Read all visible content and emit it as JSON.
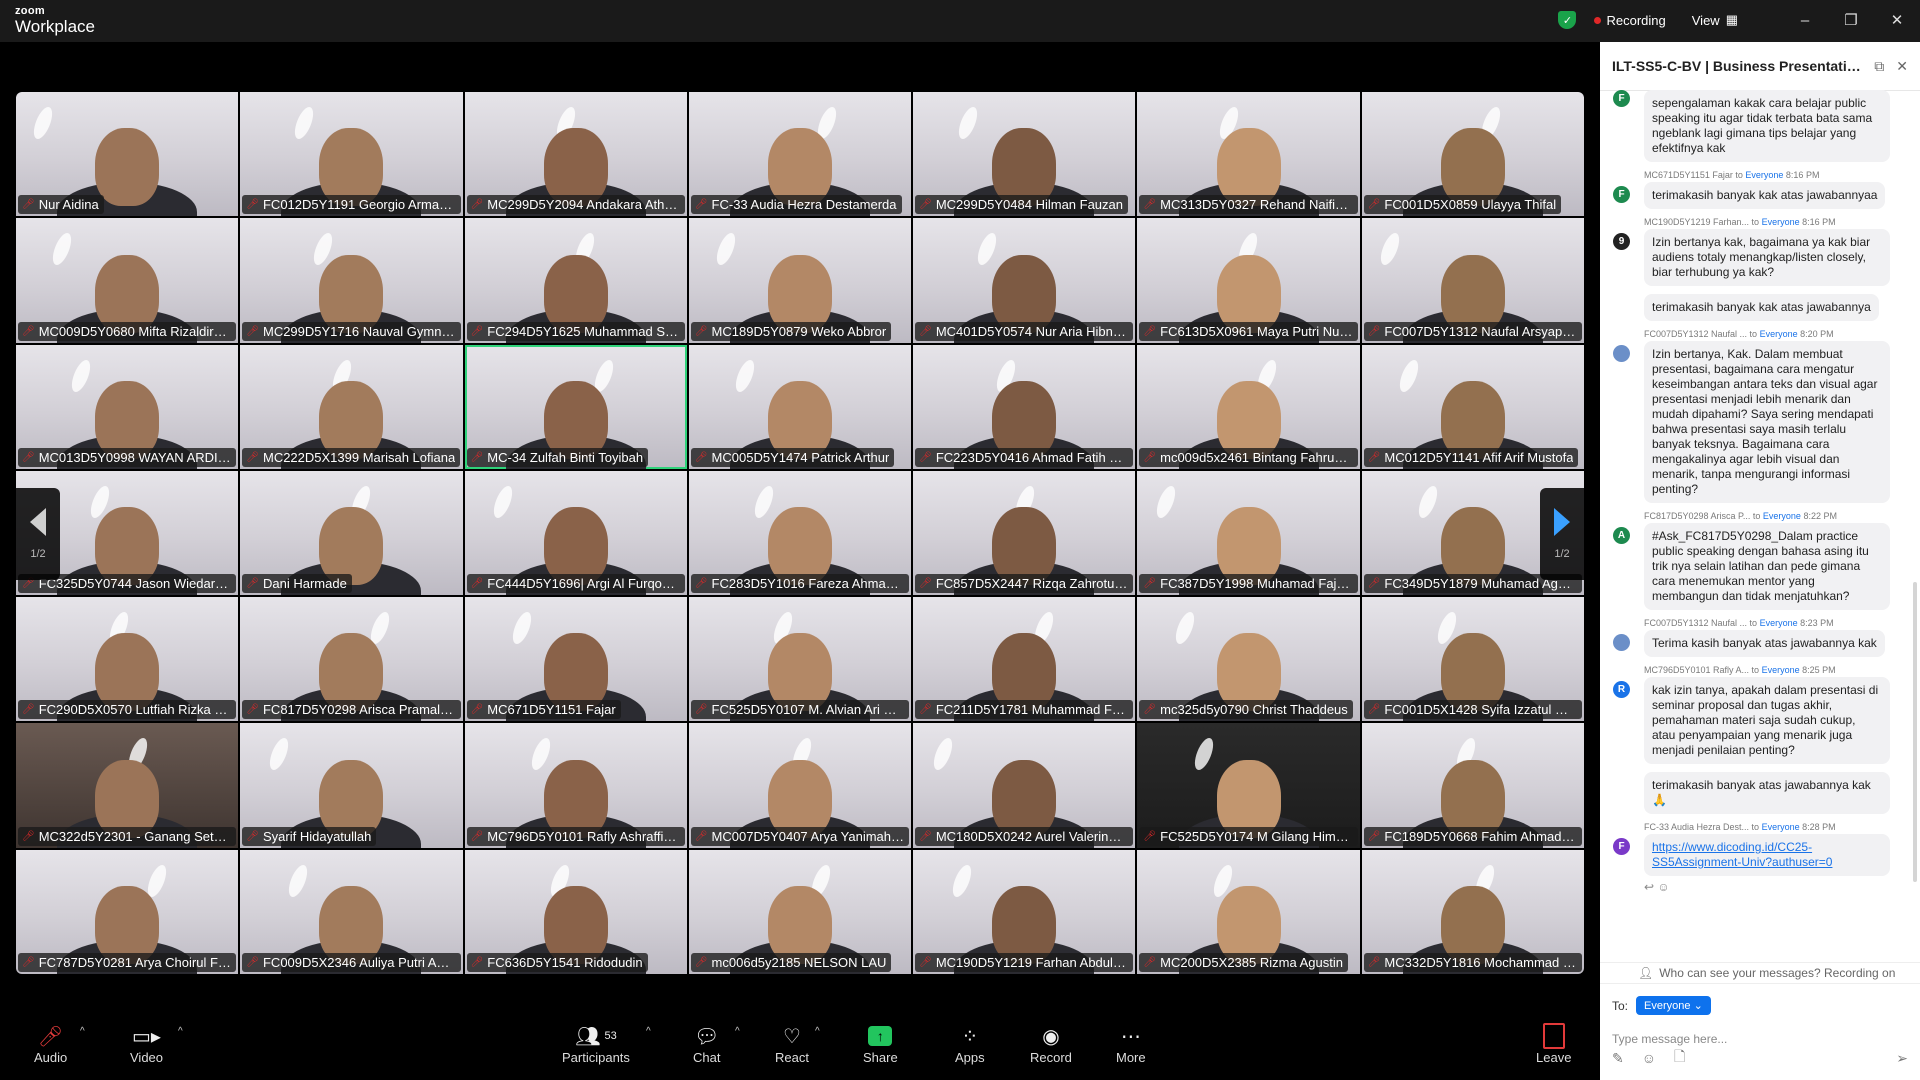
{
  "app": {
    "brand_top": "zoom",
    "brand_bottom": "Workplace"
  },
  "titlebar": {
    "recording_label": "Recording",
    "view_label": "View",
    "minimize": "–",
    "restore": "❐",
    "close": "✕"
  },
  "gallery": {
    "page_indicator_left": "1/2",
    "page_indicator_right": "1/2",
    "participants": [
      "Nur Aidina",
      "FC012D5Y1191 Georgio Armand...",
      "MC299D5Y2094 Andakara Athay...",
      "FC-33 Audia Hezra Destamerda",
      "MC299D5Y0484 Hilman Fauzan",
      "MC313D5Y0327 Rehand Naifisur...",
      "FC001D5X0859 Ulayya Thifal",
      "MC009D5Y0680 Mifta Rizaldirah...",
      "MC299D5Y1716 Nauval Gymnasti",
      "FC294D5Y1625 Muhammad Satrio",
      "MC189D5Y0879 Weko Abbror",
      "MC401D5Y0574 Nur Aria Hibnas...",
      "FC613D5X0961 Maya Putri Nur F...",
      "FC007D5Y1312 Naufal Arsyaputr...",
      "MC013D5Y0998 WAYAN ARDIKE",
      "MC222D5X1399 Marisah Lofiana",
      "MC-34 Zulfah Binti Toyibah",
      "MC005D5Y1474 Patrick Arthur",
      "FC223D5Y0416 Ahmad Fatih Hib...",
      "mc009d5x2461 Bintang Fahrunni...",
      "MC012D5Y1141 Afif Arif Mustofa",
      "FC325D5Y0744 Jason Wiedardi L...",
      "Dani Harmade",
      "FC444D5Y1696| Argi Al Furqon M",
      "FC283D5Y1016 Fareza Ahmad K...",
      "FC857D5X2447 Rizqa Zahrotun ...",
      "FC387D5Y1998 Muhamad Fajar ...",
      "FC349D5Y1879 Muhamad Agus ...",
      "FC290D5X0570 Lutfiah Rizka San...",
      "FC817D5Y0298 Arisca Pramalistyo",
      "MC671D5Y1151 Fajar",
      "FC525D5Y0107 M. Alvian Ari Nu...",
      "FC211D5Y1781 Muhammad Fad...",
      "mc325d5y0790 Christ Thaddeus",
      "FC001D5X1428 Syifa Izzatul Rah...",
      "MC322d5Y2301 - Ganang Setyo ...",
      "Syarif Hidayatullah",
      "MC796D5Y0101 Rafly Ashraffi R...",
      "MC007D5Y0407 Arya Yanimaharta",
      "MC180D5X0242  Aurel Valerine ...",
      "FC525D5Y0174 M Gilang Himaw...",
      "FC189D5Y0668 Fahim Ahmad Sa...",
      "FC787D5Y0281 Arya Choirul Fikri",
      "FC009D5X2346 Auliya Putri Assyfa",
      "FC636D5Y1541 Ridodudin",
      "mc006d5y2185 NELSON LAU",
      "MC190D5Y1219 Farhan Abdul M...",
      "MC200D5X2385 Rizma Agustin",
      "MC332D5Y1816 Mochammad Sy..."
    ]
  },
  "toolbar": {
    "audio": "Audio",
    "video": "Video",
    "participants": "Participants",
    "participants_count": "53",
    "chat": "Chat",
    "react": "React",
    "share": "Share",
    "apps": "Apps",
    "record": "Record",
    "more": "More",
    "leave": "Leave"
  },
  "chat": {
    "title": "ILT-SS5-C-BV | Business Presentation:...",
    "messages": [
      {
        "id": "m0",
        "avatar": "F",
        "color": "g",
        "meta": "",
        "to": "",
        "time": "",
        "text": "sepengalaman kakak cara belajar public speaking itu agar tidak terbata bata sama ngeblank lagi gimana tips belajar yang efektifnya kak"
      },
      {
        "id": "m1",
        "avatar": "F",
        "color": "g",
        "meta": "MC671D5Y1151 Fajar  to ",
        "to": "Everyone",
        "time": " 8:16 PM",
        "text": "terimakasih banyak kak atas jawabannyaa"
      },
      {
        "id": "m2",
        "avatar": "9",
        "color": "k",
        "meta": "MC190D5Y1219 Farhan...  to ",
        "to": "Everyone",
        "time": " 8:16 PM",
        "text": "Izin bertanya kak, bagaimana ya kak biar audiens totaly menangkap/listen closely, biar terhubung ya kak?"
      },
      {
        "id": "m2b",
        "avatar": "",
        "color": "",
        "meta": "",
        "to": "",
        "time": "",
        "text": "terimakasih banyak kak atas jawabannya"
      },
      {
        "id": "m3",
        "avatar": "",
        "color": "ph",
        "meta": "FC007D5Y1312 Naufal ...  to ",
        "to": "Everyone",
        "time": " 8:20 PM",
        "text": "Izin bertanya, Kak. Dalam membuat presentasi, bagaimana cara mengatur keseimbangan antara teks dan visual agar presentasi menjadi lebih menarik dan mudah dipahami? Saya sering mendapati bahwa presentasi saya masih terlalu banyak teksnya. Bagaimana cara mengakalinya agar lebih visual dan menarik, tanpa mengurangi informasi penting?"
      },
      {
        "id": "m4",
        "avatar": "A",
        "color": "g",
        "meta": "FC817D5Y0298 Arisca P...  to ",
        "to": "Everyone",
        "time": " 8:22 PM",
        "text": "#Ask_FC817D5Y0298_Dalam practice public speaking dengan bahasa asing itu trik nya selain latihan dan pede gimana cara menemukan mentor yang membangun dan tidak menjatuhkan?"
      },
      {
        "id": "m5",
        "avatar": "",
        "color": "ph",
        "meta": "FC007D5Y1312 Naufal ...  to ",
        "to": "Everyone",
        "time": " 8:23 PM",
        "text": "Terima kasih banyak atas jawabannya kak"
      },
      {
        "id": "m6",
        "avatar": "R",
        "color": "b",
        "meta": "MC796D5Y0101 Rafly A...  to ",
        "to": "Everyone",
        "time": " 8:25 PM",
        "text": "kak izin tanya, apakah dalam presentasi di seminar proposal dan tugas akhir, pemahaman materi saja sudah cukup, atau penyampaian yang menarik juga menjadi penilaian penting?"
      },
      {
        "id": "m6b",
        "avatar": "",
        "color": "",
        "meta": "",
        "to": "",
        "time": "",
        "text": "terimakasih banyak atas jawabannya kak 🙏"
      },
      {
        "id": "m7",
        "avatar": "F",
        "color": "p",
        "meta": "FC-33 Audia Hezra Dest...  to ",
        "to": "Everyone",
        "time": " 8:28 PM",
        "text": "https://www.dicoding.id/CC25-SS5Assignment-Univ?authuser=0",
        "link": true
      }
    ],
    "who_can_see": "Who can see your messages? Recording on",
    "to_label": "To:",
    "to_value": "Everyone",
    "input_placeholder": "Type message here..."
  }
}
